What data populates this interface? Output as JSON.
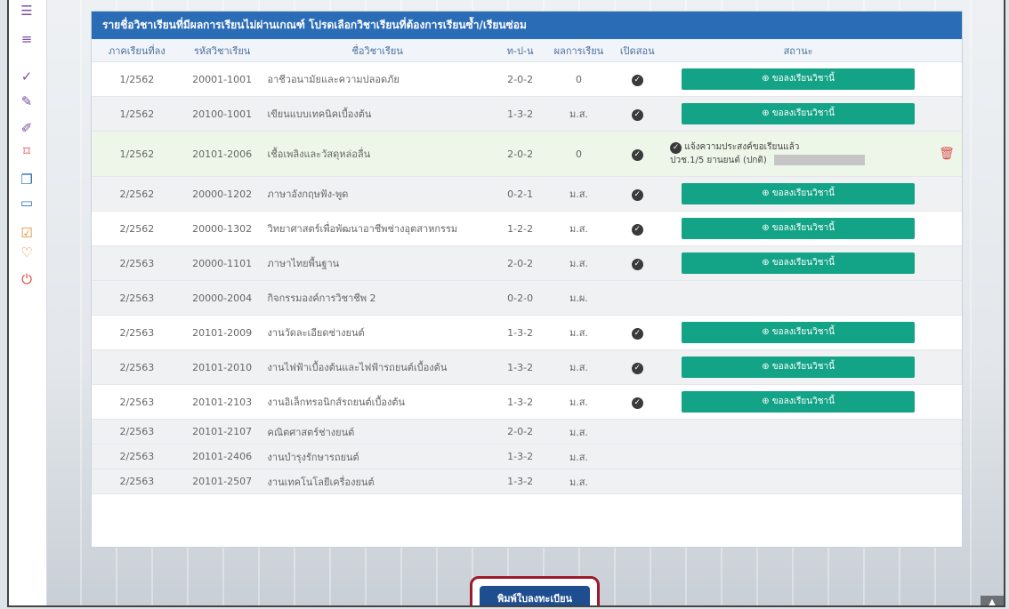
{
  "sidebar": {
    "icons": [
      "menu-icon",
      "list-icon",
      "check-icon",
      "pencil-icon",
      "edit-icon",
      "bookmark-icon",
      "copy-icon",
      "card-icon",
      "checkbox-icon",
      "heart-icon",
      "power-icon"
    ]
  },
  "panel": {
    "title": "รายชื่อวิชาเรียนที่มีผลการเรียนไม่ผ่านเกณฑ์ โปรดเลือกวิชาเรียนที่ต้องการเรียนซ้ำ/เรียนซ่อม",
    "columns": [
      "ภาคเรียนที่ลง",
      "รหัสวิชาเรียน",
      "ชื่อวิชาเรียน",
      "ท-ป-น",
      "ผลการเรียน",
      "เปิดสอน",
      "สถานะ"
    ],
    "request_label": "ขอลงเรียนวิชานี้",
    "rows": [
      {
        "term": "1/2562",
        "code": "20001-1001",
        "name": "อาชีวอนามัยและความปลอดภัย",
        "tpn": "2-0-2",
        "grade": "0",
        "open": true,
        "status": "button"
      },
      {
        "term": "1/2562",
        "code": "20100-1001",
        "name": "เขียนแบบเทคนิคเบื้องต้น",
        "tpn": "1-3-2",
        "grade": "ม.ส.",
        "open": true,
        "status": "button"
      },
      {
        "term": "1/2562",
        "code": "20101-2006",
        "name": "เชื้อเพลิงและวัสดุหล่อลื่น",
        "tpn": "2-0-2",
        "grade": "0",
        "open": true,
        "status": "note",
        "note1": "แจ้งความประสงค์ขอเรียนแล้ว",
        "note2": "ปวช.1/5 ยานยนต์ (ปกติ)"
      },
      {
        "term": "2/2562",
        "code": "20000-1202",
        "name": "ภาษาอังกฤษฟัง-พูด",
        "tpn": "0-2-1",
        "grade": "ม.ส.",
        "open": true,
        "status": "button"
      },
      {
        "term": "2/2562",
        "code": "20000-1302",
        "name": "วิทยาศาสตร์เพื่อพัฒนาอาชีพช่างอุตสาหกรรม",
        "tpn": "1-2-2",
        "grade": "ม.ส.",
        "open": true,
        "status": "button"
      },
      {
        "term": "2/2563",
        "code": "20000-1101",
        "name": "ภาษาไทยพื้นฐาน",
        "tpn": "2-0-2",
        "grade": "ม.ส.",
        "open": true,
        "status": "button"
      },
      {
        "term": "2/2563",
        "code": "20000-2004",
        "name": "กิจกรรมองค์การวิชาชีพ 2",
        "tpn": "0-2-0",
        "grade": "ม.ผ.",
        "open": false,
        "status": "none"
      },
      {
        "term": "2/2563",
        "code": "20101-2009",
        "name": "งานวัดละเอียดช่างยนต์",
        "tpn": "1-3-2",
        "grade": "ม.ส.",
        "open": true,
        "status": "button"
      },
      {
        "term": "2/2563",
        "code": "20101-2010",
        "name": "งานไฟฟ้าเบื้องต้นและไฟฟ้ารถยนต์เบื้องต้น",
        "tpn": "1-3-2",
        "grade": "ม.ส.",
        "open": true,
        "status": "button"
      },
      {
        "term": "2/2563",
        "code": "20101-2103",
        "name": "งานอิเล็กทรอนิกส์รถยนต์เบื้องต้น",
        "tpn": "1-3-2",
        "grade": "ม.ส.",
        "open": true,
        "status": "button"
      },
      {
        "term": "2/2563",
        "code": "20101-2107",
        "name": "คณิตศาสตร์ช่างยนต์",
        "tpn": "2-0-2",
        "grade": "ม.ส.",
        "open": false,
        "status": "none"
      },
      {
        "term": "2/2563",
        "code": "20101-2406",
        "name": "งานบำรุงรักษารถยนต์",
        "tpn": "1-3-2",
        "grade": "ม.ส.",
        "open": false,
        "status": "none"
      },
      {
        "term": "2/2563",
        "code": "20101-2507",
        "name": "งานเทคโนโลยีเครื่องยนต์",
        "tpn": "1-3-2",
        "grade": "ม.ส.",
        "open": false,
        "status": "none"
      }
    ]
  },
  "print_button": "พิมพ์ใบลงทะเบียน",
  "colors": {
    "header": "#2b6cb6",
    "request_button": "#13a386",
    "print_button": "#1e4e90",
    "highlight_border": "#9b1b2b"
  }
}
